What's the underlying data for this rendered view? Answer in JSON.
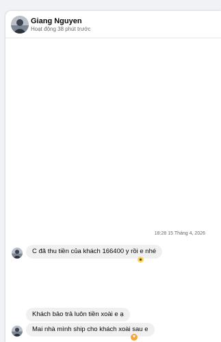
{
  "header": {
    "name": "Giang Nguyen",
    "status": "Hoạt động 38 phút trước"
  },
  "conversation": {
    "timestamp": "18:28 15 Tháng 4, 2026",
    "messages": [
      {
        "text": "C đã thu tiền của khách 166400 y rồi e nhé",
        "reaction": "sunflower"
      },
      {
        "text": "Khách bảo trả luôn tiền xoài e ạ",
        "reaction": ""
      },
      {
        "text": "Mai nhà mình ship cho khách xoài sau e",
        "reaction": "heart"
      }
    ]
  },
  "colors": {
    "bubble": "#f0f0f0",
    "muted_text": "#65676b",
    "page_background": "#f0f2f5"
  }
}
